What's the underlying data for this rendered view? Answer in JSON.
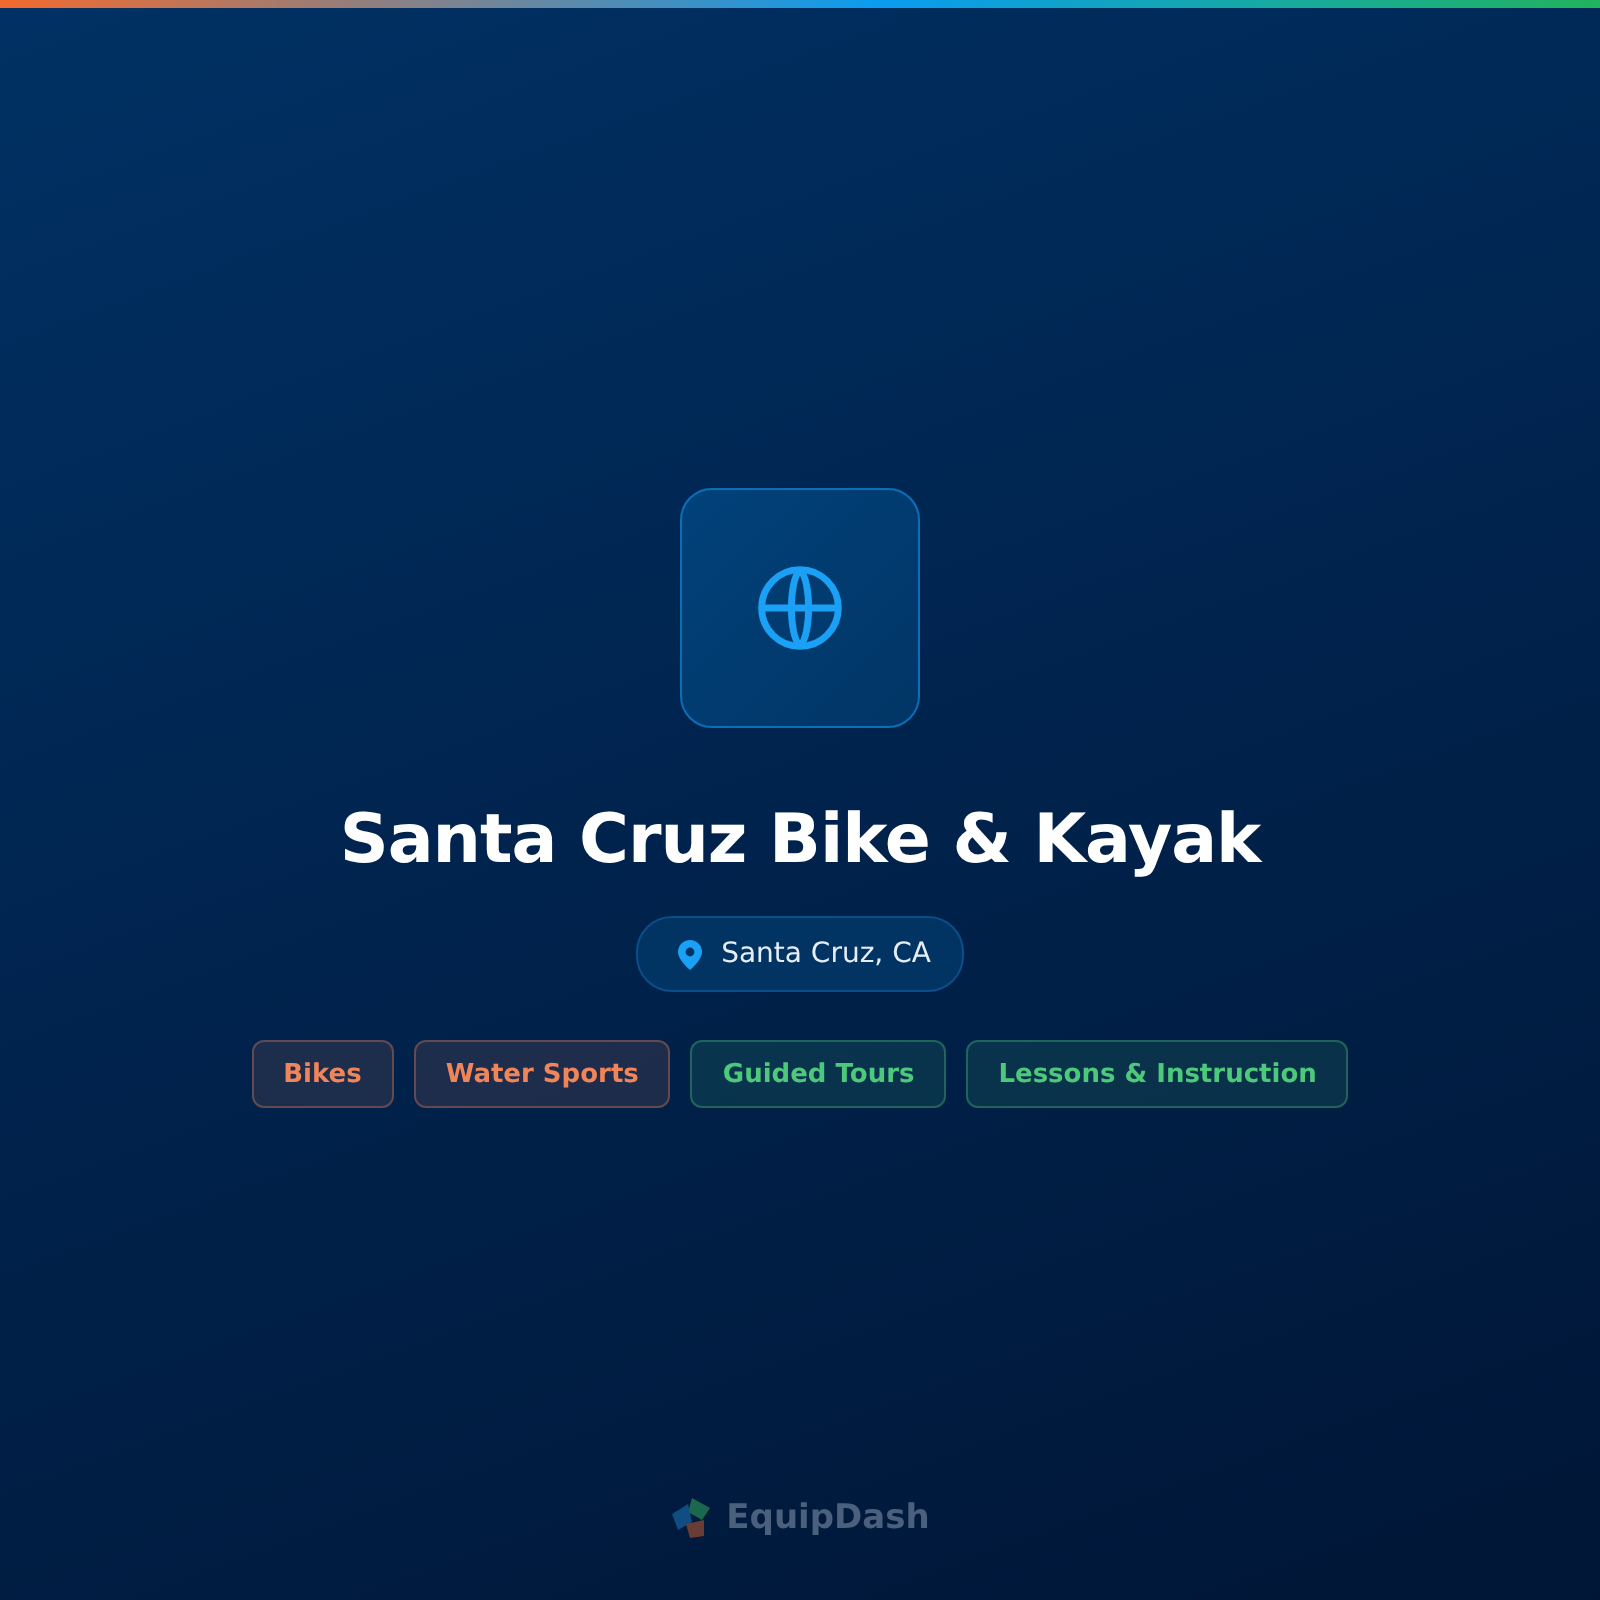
{
  "title": "Santa Cruz Bike & Kayak",
  "location": "Santa Cruz, CA",
  "tags": [
    {
      "label": "Bikes",
      "color": "#f0855a"
    },
    {
      "label": "Water Sports",
      "color": "#f0855a"
    },
    {
      "label": "Guided Tours",
      "color": "#4cc97a"
    },
    {
      "label": "Lessons & Instruction",
      "color": "#4cc97a"
    }
  ],
  "brand": "EquipDash"
}
